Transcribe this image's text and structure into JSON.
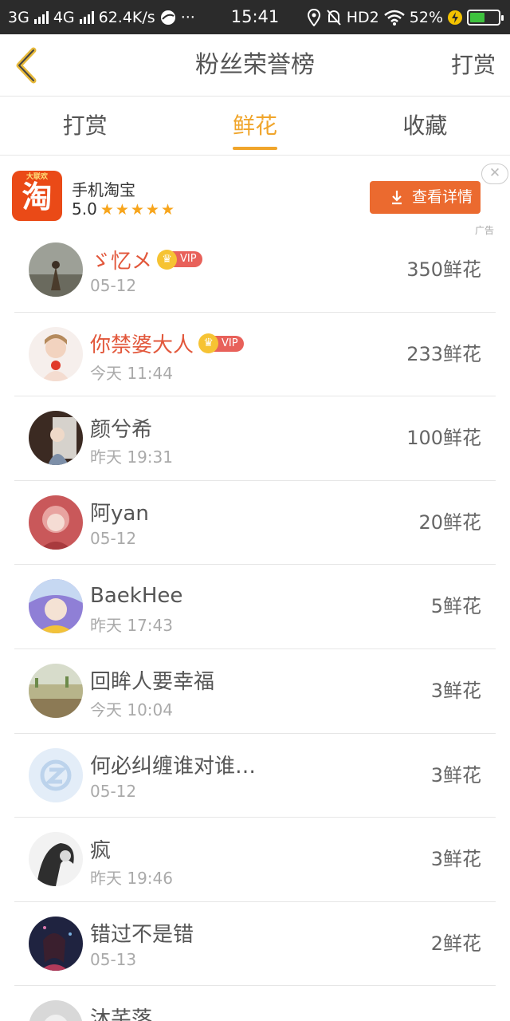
{
  "status_bar": {
    "net1": "3G",
    "net2": "4G",
    "speed": "62.4K/s",
    "more": "···",
    "time": "15:41",
    "hd": "HD2",
    "battery": "52%",
    "battery_level": 0.52
  },
  "header": {
    "back_icon": "chevron-left-icon",
    "title": "粉丝荣誉榜",
    "action": "打赏"
  },
  "tabs": [
    {
      "label": "打赏"
    },
    {
      "label": "鲜花"
    },
    {
      "label": "收藏"
    }
  ],
  "active_tab": "鲜花",
  "ad": {
    "icon_text": "淘",
    "icon_banner": "大联欢",
    "app_name": "手机淘宝",
    "rating": "5.0",
    "stars": "★★★★★",
    "button": "查看详情",
    "close": "✕",
    "tag": "广告"
  },
  "list": [
    {
      "name": "ゞ忆メ",
      "vip": true,
      "time": "05-12",
      "count": "350鲜花"
    },
    {
      "name": "你禁婆大人",
      "vip": true,
      "time": "今天 11:44",
      "count": "233鲜花"
    },
    {
      "name": "颜兮希",
      "vip": false,
      "time": "昨天 19:31",
      "count": "100鲜花"
    },
    {
      "name": "阿yan",
      "vip": false,
      "time": "05-12",
      "count": "20鲜花"
    },
    {
      "name": "BaekHee",
      "vip": false,
      "time": "昨天 17:43",
      "count": "5鲜花"
    },
    {
      "name": "回眸人要幸福",
      "vip": false,
      "time": "今天 10:04",
      "count": "3鲜花"
    },
    {
      "name": "何必纠缠谁对谁…",
      "vip": false,
      "time": "05-12",
      "count": "3鲜花"
    },
    {
      "name": "疯",
      "vip": false,
      "time": "昨天 19:46",
      "count": "3鲜花"
    },
    {
      "name": "错过不是错",
      "vip": false,
      "time": "05-13",
      "count": "2鲜花"
    },
    {
      "name": "沐芊落",
      "vip": false,
      "time": "",
      "count": ""
    }
  ],
  "vip_label": "VIP",
  "crown_glyph": "♛"
}
